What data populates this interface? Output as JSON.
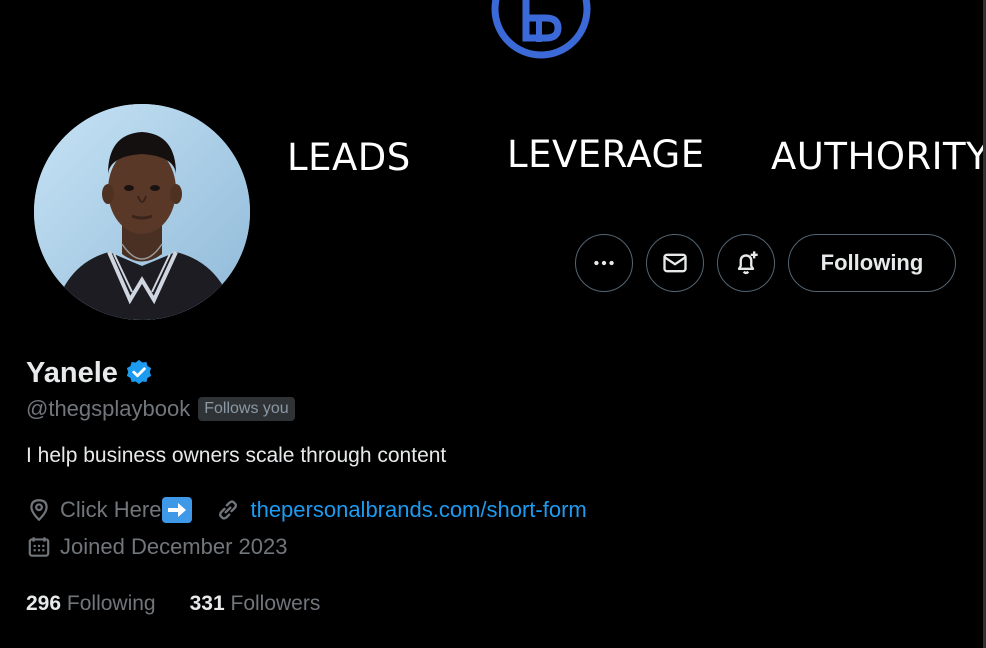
{
  "banner": {
    "words": [
      "LEADS",
      "LEVERAGE",
      "AUTHORITY"
    ],
    "logo_icon": "pb-monogram-icon",
    "colors": {
      "logo": "#3b6ad8"
    }
  },
  "actions": {
    "more_icon": "more-icon",
    "message_icon": "mail-icon",
    "notify_icon": "bell-plus-icon",
    "follow_label": "Following"
  },
  "profile": {
    "name": "Yanele",
    "verified_icon": "verified-badge-icon",
    "handle": "@thegsplaybook",
    "follows_you": "Follows you",
    "bio": "I help business owners scale through content",
    "location_icon": "location-pin-icon",
    "location": "Click Here",
    "location_arrow_icon": "right-arrow-emoji-icon",
    "link_icon": "link-icon",
    "link": "thepersonalbrands.com/short-form",
    "joined_icon": "calendar-icon",
    "joined": "Joined December 2023",
    "following_count": "296",
    "following_label": "Following",
    "followers_count": "331",
    "followers_label": "Followers"
  },
  "colors": {
    "background": "#000000",
    "text": "#e7e9ea",
    "muted": "#71767b",
    "link": "#1d9bf0",
    "verified": "#1d9bf0"
  }
}
